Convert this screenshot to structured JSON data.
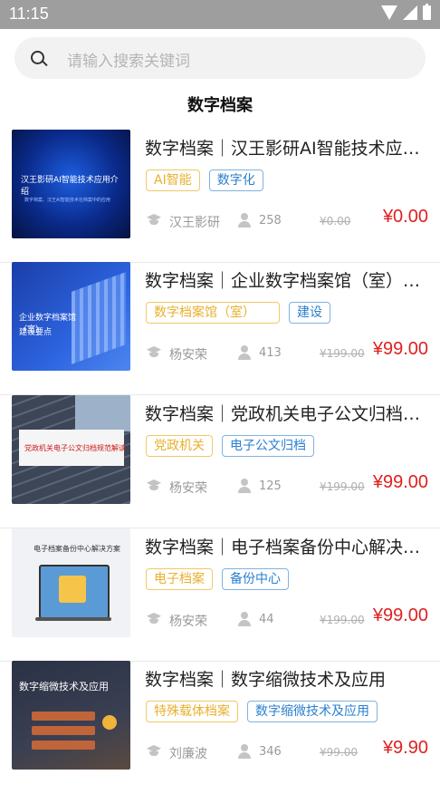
{
  "status_bar": {
    "time": "11:15"
  },
  "search": {
    "placeholder": "请输入搜索关键词"
  },
  "page_title": "数字档案",
  "courses": [
    {
      "title": "数字档案｜汉王影研AI智能技术应用介绍",
      "thumb_lines": [
        "汉王影研AI智能技术应用介绍",
        "数字档案、汉王AI智能技术在档案中的应用"
      ],
      "tags": [
        "AI智能",
        "数字化"
      ],
      "teacher": "汉王影研",
      "views": "258",
      "original_price": "¥0.00",
      "price": "¥0.00"
    },
    {
      "title": "数字档案｜企业数字档案馆（室）建设要点",
      "thumb_lines": [
        "企业数字档案馆（室）",
        "建设要点"
      ],
      "tags": [
        "数字档案馆（室）",
        "建设"
      ],
      "teacher": "杨安荣",
      "views": "413",
      "original_price": "¥199.00",
      "price": "¥99.00"
    },
    {
      "title": "数字档案｜党政机关电子公文归档规范解读",
      "thumb_lines": [
        "党政机关电子公文归档规范解读"
      ],
      "tags": [
        "党政机关",
        "电子公文归档"
      ],
      "teacher": "杨安荣",
      "views": "125",
      "original_price": "¥199.00",
      "price": "¥99.00"
    },
    {
      "title": "数字档案｜电子档案备份中心解决方案",
      "thumb_lines": [
        "电子档案备份中心解决方案"
      ],
      "tags": [
        "电子档案",
        "备份中心"
      ],
      "teacher": "杨安荣",
      "views": "44",
      "original_price": "¥199.00",
      "price": "¥99.00"
    },
    {
      "title": "数字档案｜数字缩微技术及应用",
      "thumb_lines": [
        "数字缩微技术及应用"
      ],
      "tags": [
        "特殊载体档案",
        "数字缩微技术及应用"
      ],
      "teacher": "刘廉波",
      "views": "346",
      "original_price": "¥99.00",
      "price": "¥9.90"
    }
  ],
  "colors": {
    "price": "#e02020",
    "tag_yellow": "#e8b02e",
    "tag_blue": "#2a7fcf"
  }
}
